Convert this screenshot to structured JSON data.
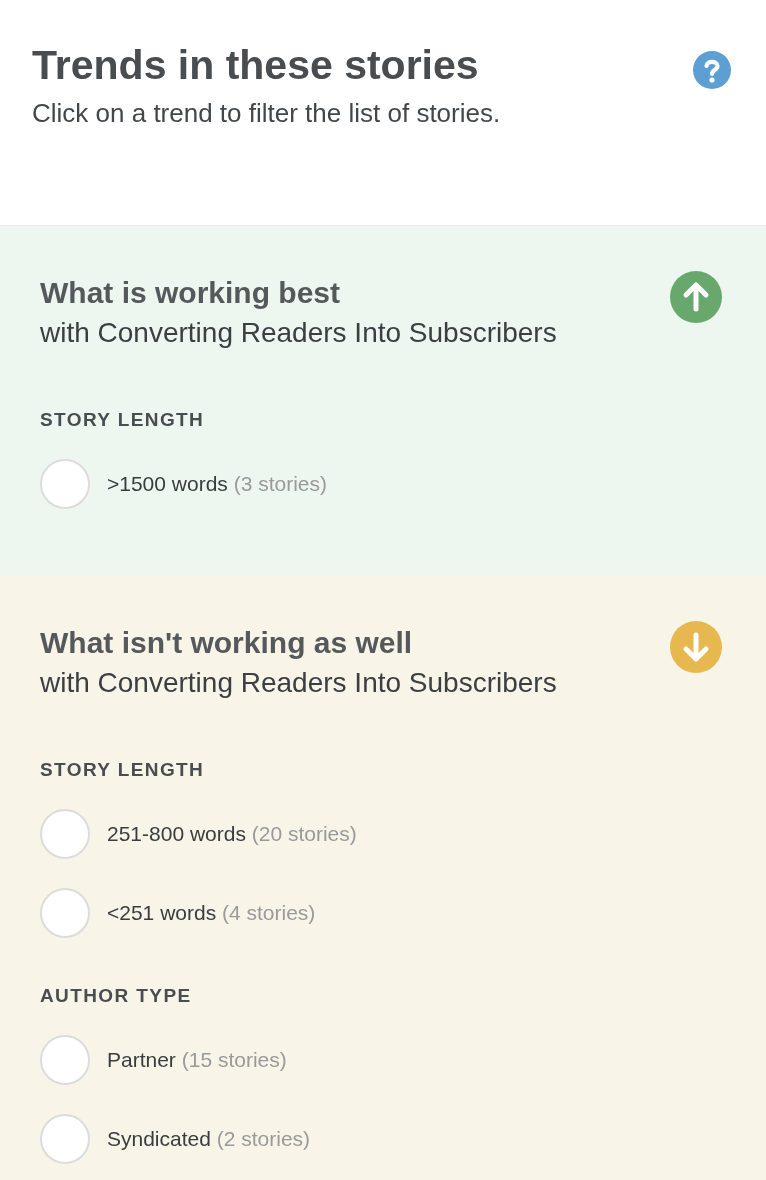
{
  "header": {
    "title": "Trends in these stories",
    "subtitle": "Click on a trend to filter the list of stories."
  },
  "sections": [
    {
      "kind": "up",
      "title": "What is working best",
      "subtitle": "with Converting Readers Into Subscribers",
      "groups": [
        {
          "heading": "STORY LENGTH",
          "options": [
            {
              "label": ">1500 words",
              "count": "(3 stories)",
              "selected": false
            }
          ]
        }
      ]
    },
    {
      "kind": "down",
      "title": "What isn't working as well",
      "subtitle": "with Converting Readers Into Subscribers",
      "groups": [
        {
          "heading": "STORY LENGTH",
          "options": [
            {
              "label": "251-800 words",
              "count": "(20 stories)",
              "selected": false
            },
            {
              "label": "<251 words",
              "count": "(4 stories)",
              "selected": false
            }
          ]
        },
        {
          "heading": "AUTHOR TYPE",
          "options": [
            {
              "label": "Partner",
              "count": "(15 stories)",
              "selected": false
            },
            {
              "label": "Syndicated",
              "count": "(2 stories)",
              "selected": false
            }
          ]
        }
      ]
    }
  ]
}
